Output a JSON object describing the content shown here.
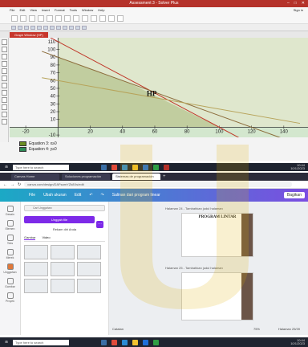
{
  "top_window": {
    "title": "Assessment 3 - Solver Plus",
    "window_controls": [
      "–",
      "□",
      "✕"
    ],
    "menu": [
      "File",
      "Edit",
      "View",
      "Insert",
      "Format",
      "Tools",
      "Window",
      "Help"
    ],
    "user": "Sign in",
    "tab_label": "Graph Window (HP)",
    "legend": [
      {
        "label": "Equation 3: x≥0",
        "color": "#6b8e23"
      },
      {
        "label": "Equation 4: y≥0",
        "color": "#2e8b57"
      }
    ]
  },
  "chart_data": {
    "type": "line",
    "xlim": [
      -30,
      155
    ],
    "ylim": [
      -13,
      115
    ],
    "x_ticks": [
      "-20",
      "20",
      "40",
      "60",
      "80",
      "100",
      "120",
      "140"
    ],
    "y_ticks": [
      "-10",
      "10",
      "20",
      "30",
      "40",
      "50",
      "60",
      "70",
      "80",
      "90",
      "100",
      "110"
    ],
    "region_label": "HP",
    "series": [
      {
        "color": "#c0392b",
        "points": [
          [
            0,
            110
          ],
          [
            100,
            0
          ]
        ]
      },
      {
        "color": "#8b6b3a",
        "points": [
          [
            0,
            90
          ],
          [
            120,
            0
          ]
        ]
      },
      {
        "color": "#b7a35a",
        "points": [
          [
            0,
            60
          ],
          [
            150,
            5
          ]
        ]
      }
    ],
    "feasible_region": [
      [
        0,
        0
      ],
      [
        0,
        90
      ],
      [
        45,
        56
      ],
      [
        100,
        0
      ]
    ]
  },
  "taskbar_top": {
    "search_placeholder": "Type here to search",
    "time": "10:44",
    "date": "10/1/2023"
  },
  "browser": {
    "tabs": [
      "Canvas Home",
      "Soluciones programación",
      "Sistemas de programación",
      "+"
    ],
    "url": "canva.com/design/DAFsamYZk8Xs/edit"
  },
  "canva": {
    "menu": [
      "File",
      "Ubah ukuran",
      "Edit"
    ],
    "doc_title": "Salinan dari program linear",
    "share": "Bagikan",
    "sidebar": [
      "Desain",
      "Elemen",
      "Teks",
      "Merek",
      "Unggahan",
      "Gambar",
      "Proyek"
    ],
    "search_placeholder": "Cari Unggahan",
    "upload_button": "Unggah file",
    "brand_label": "Rekam diri Anda",
    "subtabs": [
      "Gambar",
      "Video"
    ],
    "page_header": "Halaman 24 - Tambahkan judul halaman",
    "page_title": "PROGRAM LINTAR",
    "page_header2": "Halaman 25 - Tambahkan judul halaman",
    "notes": "Catatan",
    "zoom": "75%",
    "pages": "Halaman 25/39"
  },
  "taskbar_bottom": {
    "search_placeholder": "Type here to search",
    "time": "10:44",
    "date": "10/1/2023"
  }
}
